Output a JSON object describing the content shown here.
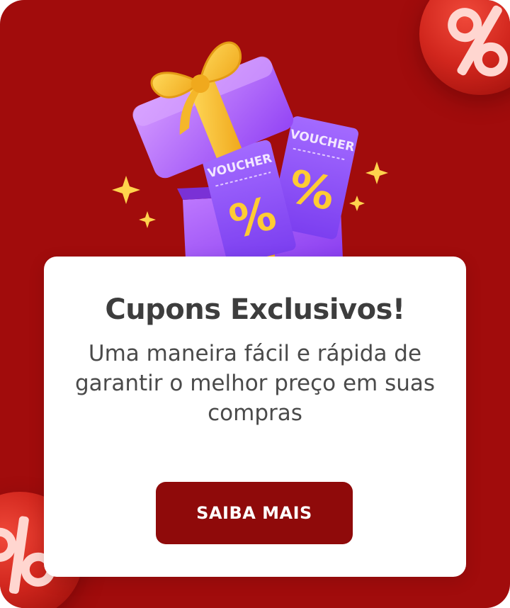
{
  "card": {
    "title": "Cupons Exclusivos!",
    "description": "Uma maneira fácil e rápida de garantir o melhor preço em suas compras",
    "cta_label": "SAIBA MAIS"
  },
  "illustration": {
    "voucher_left_label": "VOUCHER",
    "voucher_right_label": "VOUCHER",
    "voucher_symbol": "%"
  },
  "decor": {
    "bubble_symbol": "%"
  },
  "colors": {
    "background": "#a10c0c",
    "button": "#8f0a0a",
    "gift_purple": "#9b4dff",
    "ribbon_yellow": "#f7c531",
    "text_dark": "#3d3d3d"
  },
  "icons": [
    "percent-bubble-icon",
    "gift-box-icon",
    "voucher-icon",
    "sparkle-icon"
  ]
}
